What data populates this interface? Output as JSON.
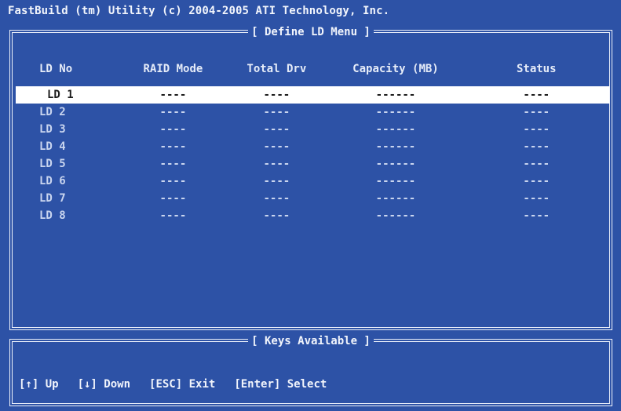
{
  "title": "FastBuild (tm) Utility (c) 2004-2005 ATI Technology, Inc.",
  "main_panel": {
    "title": "[ Define LD Menu ]",
    "columns": [
      "LD No",
      "RAID Mode",
      "Total Drv",
      "Capacity (MB)",
      "Status"
    ],
    "rows": [
      {
        "ld": "LD 1",
        "raid": "----",
        "drv": "----",
        "cap": "------",
        "status": "----"
      },
      {
        "ld": "LD 2",
        "raid": "----",
        "drv": "----",
        "cap": "------",
        "status": "----"
      },
      {
        "ld": "LD 3",
        "raid": "----",
        "drv": "----",
        "cap": "------",
        "status": "----"
      },
      {
        "ld": "LD 4",
        "raid": "----",
        "drv": "----",
        "cap": "------",
        "status": "----"
      },
      {
        "ld": "LD 5",
        "raid": "----",
        "drv": "----",
        "cap": "------",
        "status": "----"
      },
      {
        "ld": "LD 6",
        "raid": "----",
        "drv": "----",
        "cap": "------",
        "status": "----"
      },
      {
        "ld": "LD 7",
        "raid": "----",
        "drv": "----",
        "cap": "------",
        "status": "----"
      },
      {
        "ld": "LD 8",
        "raid": "----",
        "drv": "----",
        "cap": "------",
        "status": "----"
      }
    ],
    "selected_row": 0
  },
  "keys_panel": {
    "title": "[ Keys Available ]",
    "keys": [
      "[↑] Up",
      "[↓] Down",
      "[ESC] Exit",
      "[Enter] Select"
    ]
  },
  "colors": {
    "background": "#2d52a6",
    "border": "#eef2fb",
    "selection": "#ffffff"
  }
}
